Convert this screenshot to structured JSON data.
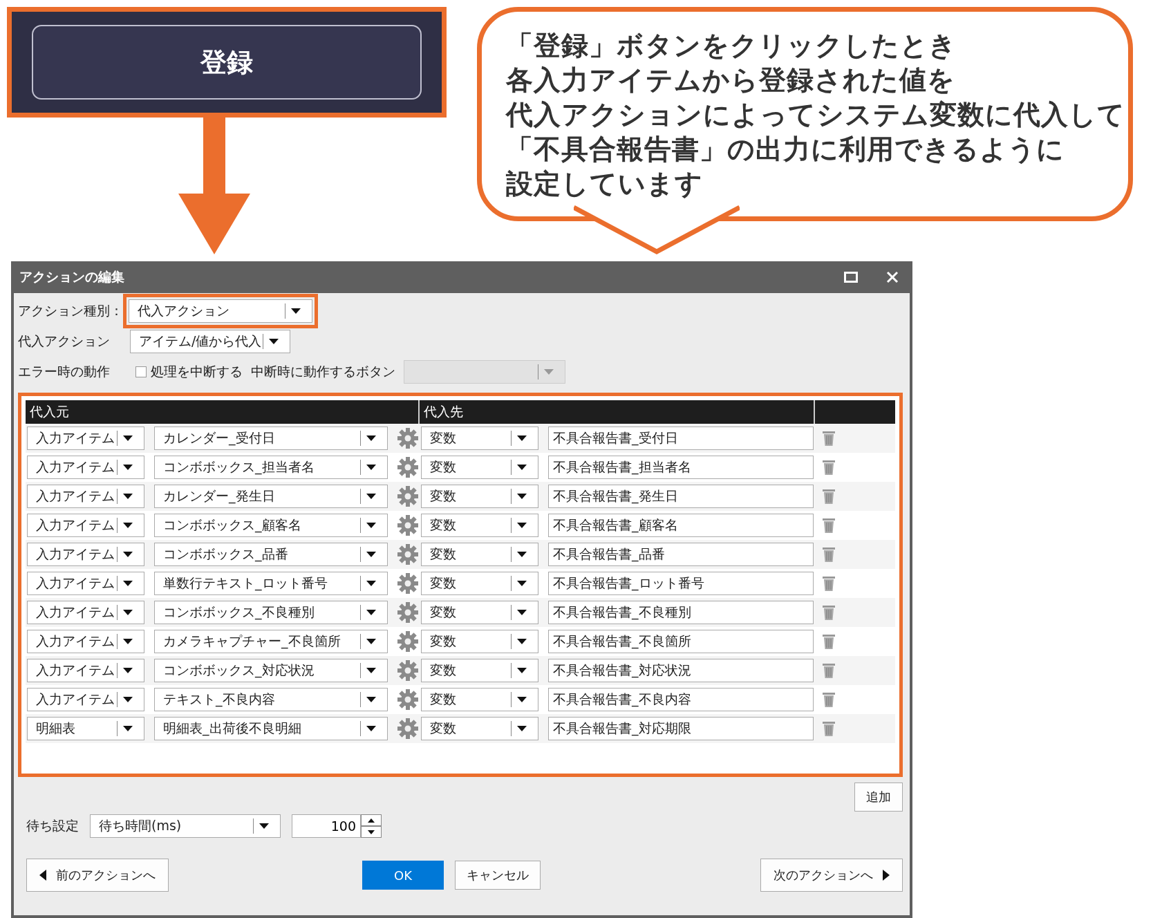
{
  "annotation": {
    "button_label": "登録",
    "callout": [
      "「登録」ボタンをクリックしたとき",
      "各入力アイテムから登録された値を",
      "代入アクションによってシステム変数に代入して",
      "「不具合報告書」の出力に利用できるように",
      "設定しています"
    ]
  },
  "dialog": {
    "title": "アクションの編集",
    "action_type": {
      "label": "アクション種別：",
      "value": "代入アクション"
    },
    "assign_action": {
      "label": "代入アクション",
      "value": "アイテム/値から代入"
    },
    "on_error": {
      "label": "エラー時の動作",
      "checkbox_label": "処理を中断する",
      "checked": false,
      "button_label": "中断時に動作するボタン"
    },
    "columns": [
      "代入元",
      "代入先"
    ],
    "rows": [
      {
        "source_type": "入力アイテム",
        "source": "カレンダー_受付日",
        "target_type": "変数",
        "target": "不具合報告書_受付日"
      },
      {
        "source_type": "入力アイテム",
        "source": "コンボボックス_担当者名",
        "target_type": "変数",
        "target": "不具合報告書_担当者名"
      },
      {
        "source_type": "入力アイテム",
        "source": "カレンダー_発生日",
        "target_type": "変数",
        "target": "不具合報告書_発生日"
      },
      {
        "source_type": "入力アイテム",
        "source": "コンボボックス_顧客名",
        "target_type": "変数",
        "target": "不具合報告書_顧客名"
      },
      {
        "source_type": "入力アイテム",
        "source": "コンボボックス_品番",
        "target_type": "変数",
        "target": "不具合報告書_品番"
      },
      {
        "source_type": "入力アイテム",
        "source": "単数行テキスト_ロット番号",
        "target_type": "変数",
        "target": "不具合報告書_ロット番号"
      },
      {
        "source_type": "入力アイテム",
        "source": "コンボボックス_不良種別",
        "target_type": "変数",
        "target": "不具合報告書_不良種別"
      },
      {
        "source_type": "入力アイテム",
        "source": "カメラキャプチャー_不良箇所",
        "target_type": "変数",
        "target": "不具合報告書_不良箇所"
      },
      {
        "source_type": "入力アイテム",
        "source": "コンボボックス_対応状況",
        "target_type": "変数",
        "target": "不具合報告書_対応状況"
      },
      {
        "source_type": "入力アイテム",
        "source": "テキスト_不良内容",
        "target_type": "変数",
        "target": "不具合報告書_不良内容"
      },
      {
        "source_type": "明細表",
        "source": "明細表_出荷後不良明細",
        "target_type": "変数",
        "target": "不具合報告書_対応期限"
      }
    ],
    "add_button": "追加",
    "wait": {
      "label": "待ち設定",
      "mode": "待ち時間(ms)",
      "value": "100"
    },
    "buttons": {
      "prev": "前のアクションへ",
      "ok": "OK",
      "cancel": "キャンセル",
      "next": "次のアクションへ"
    }
  }
}
